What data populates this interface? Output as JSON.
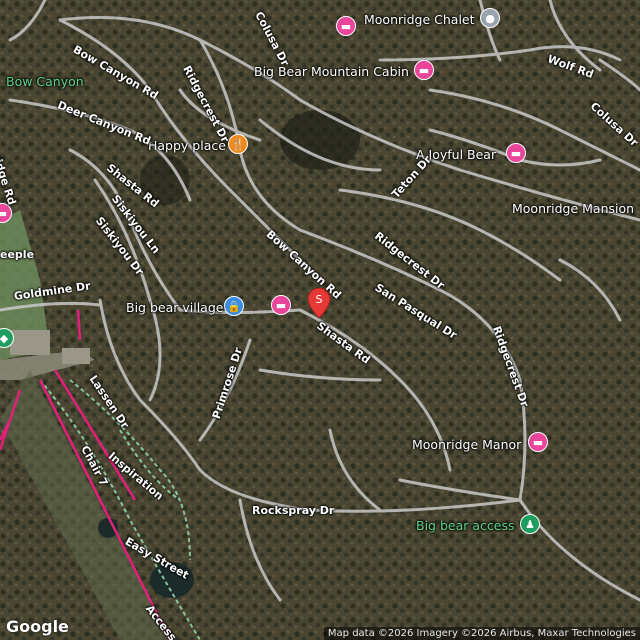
{
  "colors": {
    "road": "#c9c9c9",
    "ski_lift": "#e0207a",
    "trail": "#8fd3a8",
    "hotel_pin": "#e8459b",
    "food_pin": "#f08a1c",
    "shop_pin": "#3a8de0",
    "park_pin": "#1e9e60",
    "marker": "#e53935"
  },
  "pois": {
    "moonridge_chalet": "Moonridge Chalet",
    "big_bear_mountain_cabin": "Big Bear Mountain Cabin",
    "happy_place": "Happy place",
    "a_joyful_bear": "A Joyful Bear",
    "moonridge_mansion": "Moonridge Mansion",
    "big_bear_village": "Big bear village",
    "moonridge_manor": "Moonridge Manor",
    "big_bear_access": "Big bear access",
    "bow_canyon": "Bow Canyon"
  },
  "roads": {
    "colusa_dr_top": "Colusa Dr",
    "wolf_rd": "Wolf Rd",
    "colusa_dr_right": "Colusa Dr",
    "bow_canyon_rd_top": "Bow Canyon Rd",
    "ridgecrest_dr_top": "Ridgecrest Dr",
    "deer_canyon_rd": "Deer Canyon Rd",
    "ridge_rd": "ridge Rd",
    "teton_dr": "Teton Dr",
    "shasta_rd_left": "Shasta Rd",
    "siskiyou_ln": "Siskiyou Ln",
    "siskiyou_dr": "Siskiyou Dr",
    "bow_canyon_rd_mid": "Bow Canyon Rd",
    "ridgecrest_dr_mid": "Ridgecrest Dr",
    "san_pasqual_dr": "San Pasqual Dr",
    "ridgecrest_dr_right": "Ridgecrest Dr",
    "goldmine_dr": "Goldmine Dr",
    "shasta_rd_mid": "Shasta Rd",
    "primrose_dr": "Primrose Dr",
    "lassen_dr": "Lassen Dr",
    "chair_7": "Chair 7",
    "inspiration": "Inspiration",
    "rockspray_dr": "Rockspray Dr",
    "easy_street": "Easy Street",
    "access_xpress": "Access Xpre",
    "eeple": "eeple"
  },
  "marker": {
    "glyph": "S"
  },
  "footer": {
    "google": "Google",
    "attribution": "Map data ©2026 Imagery ©2026 Airbus, Maxar Technologies"
  },
  "icons": {
    "hotel": "hotel-icon",
    "food": "fork-knife-icon",
    "shop": "shopping-bag-icon",
    "park": "hiker-icon",
    "place": "place-pin-icon"
  }
}
